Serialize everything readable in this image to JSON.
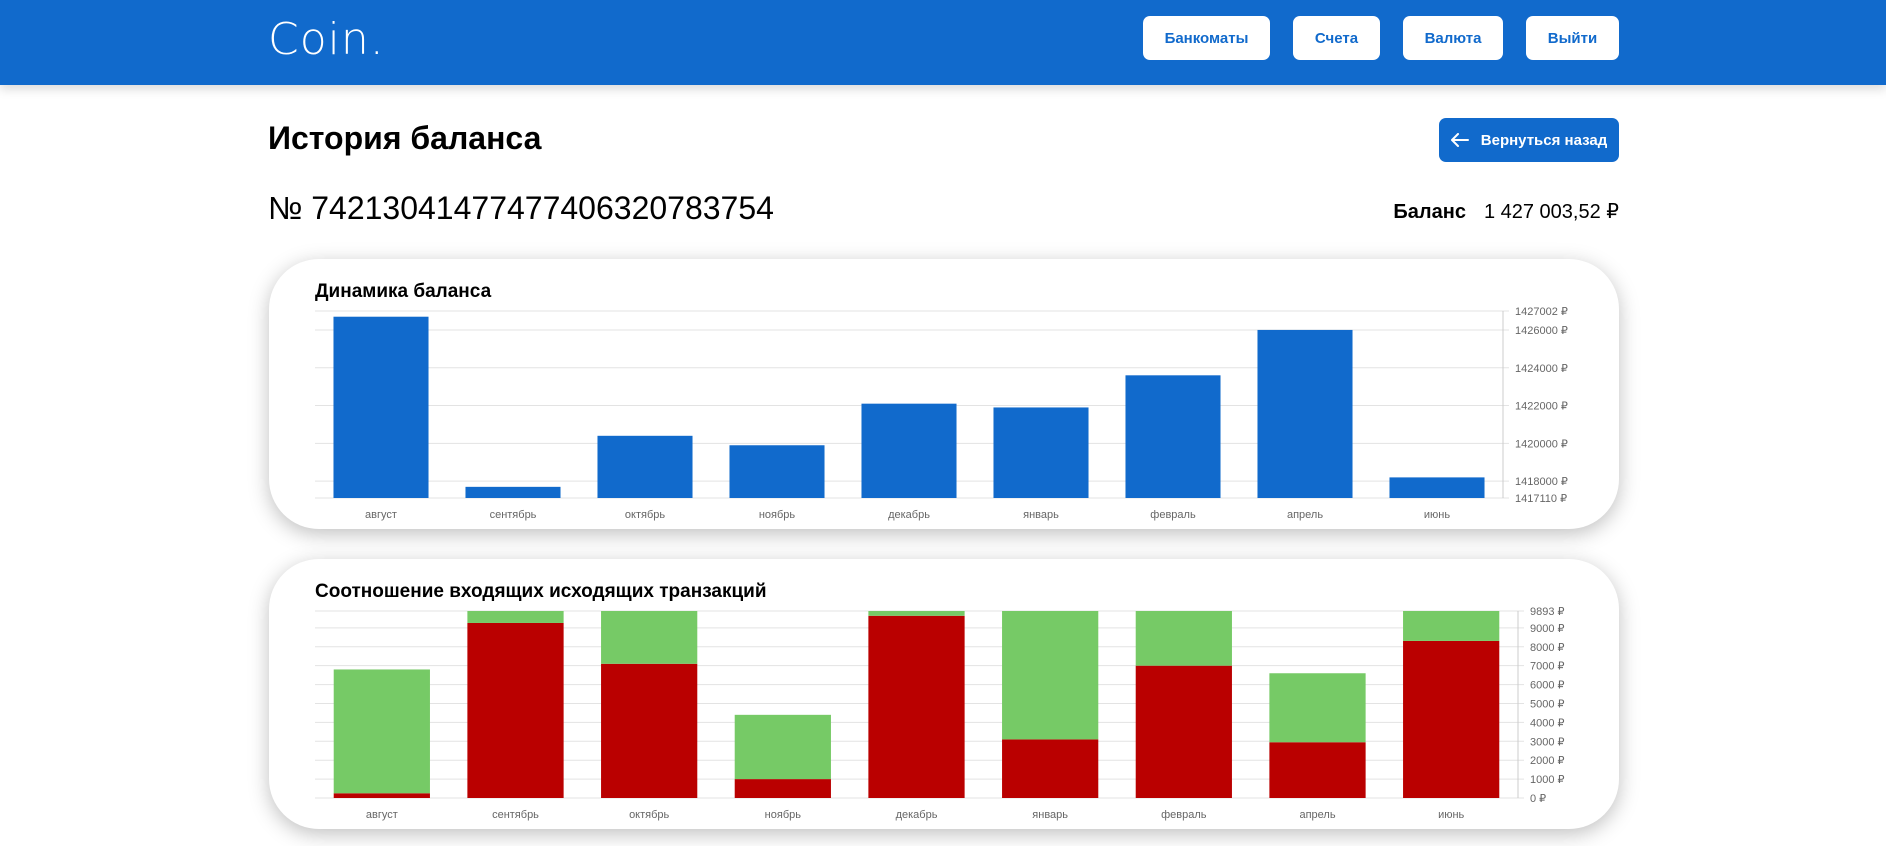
{
  "header": {
    "logo": "Coin.",
    "nav": [
      "Банкоматы",
      "Счета",
      "Валюта",
      "Выйти"
    ]
  },
  "page": {
    "title": "История баланса",
    "back_button": "Вернуться назад",
    "account_number": "№ 74213041477477406320783754",
    "balance_label": "Баланс",
    "balance_value": "1 427 003,52 ₽"
  },
  "colors": {
    "accent": "#116acc",
    "income": "#76ca66",
    "outgoing": "#ba0000"
  },
  "chart_data": [
    {
      "type": "bar",
      "title": "Динамика баланса",
      "categories": [
        "август",
        "сентябрь",
        "октябрь",
        "ноябрь",
        "декабрь",
        "январь",
        "февраль",
        "апрель",
        "июнь"
      ],
      "values": [
        1426700,
        1417700,
        1420400,
        1419900,
        1422100,
        1421900,
        1423600,
        1426000,
        1418200
      ],
      "ylim": [
        1417110,
        1427002
      ],
      "y_ticks": [
        1417110,
        1418000,
        1420000,
        1422000,
        1424000,
        1426000,
        1427002
      ],
      "y_tick_labels": [
        "1417110 ₽",
        "1418000 ₽",
        "1420000 ₽",
        "1422000 ₽",
        "1424000 ₽",
        "1426000 ₽",
        "1427002 ₽"
      ],
      "grid": true
    },
    {
      "type": "bar",
      "stacked": true,
      "title": "Соотношение входящих исходящих транзакций",
      "categories": [
        "август",
        "сентябрь",
        "октябрь",
        "ноябрь",
        "декабрь",
        "январь",
        "февраль",
        "апрель",
        "июнь"
      ],
      "series": [
        {
          "color": "#ba0000",
          "values": [
            250,
            9260,
            7100,
            1000,
            9640,
            3100,
            7000,
            2950,
            8310
          ]
        },
        {
          "color": "#76ca66",
          "values": [
            6550,
            633,
            2793,
            3400,
            253,
            6793,
            2893,
            3650,
            1583
          ]
        }
      ],
      "ylim": [
        0,
        9893
      ],
      "y_ticks": [
        0,
        1000,
        2000,
        3000,
        4000,
        5000,
        6000,
        7000,
        8000,
        9000,
        9893
      ],
      "y_tick_labels": [
        "0 ₽",
        "1000 ₽",
        "2000 ₽",
        "3000 ₽",
        "4000 ₽",
        "5000 ₽",
        "6000 ₽",
        "7000 ₽",
        "8000 ₽",
        "9000 ₽",
        "9893 ₽"
      ],
      "grid": true
    }
  ]
}
